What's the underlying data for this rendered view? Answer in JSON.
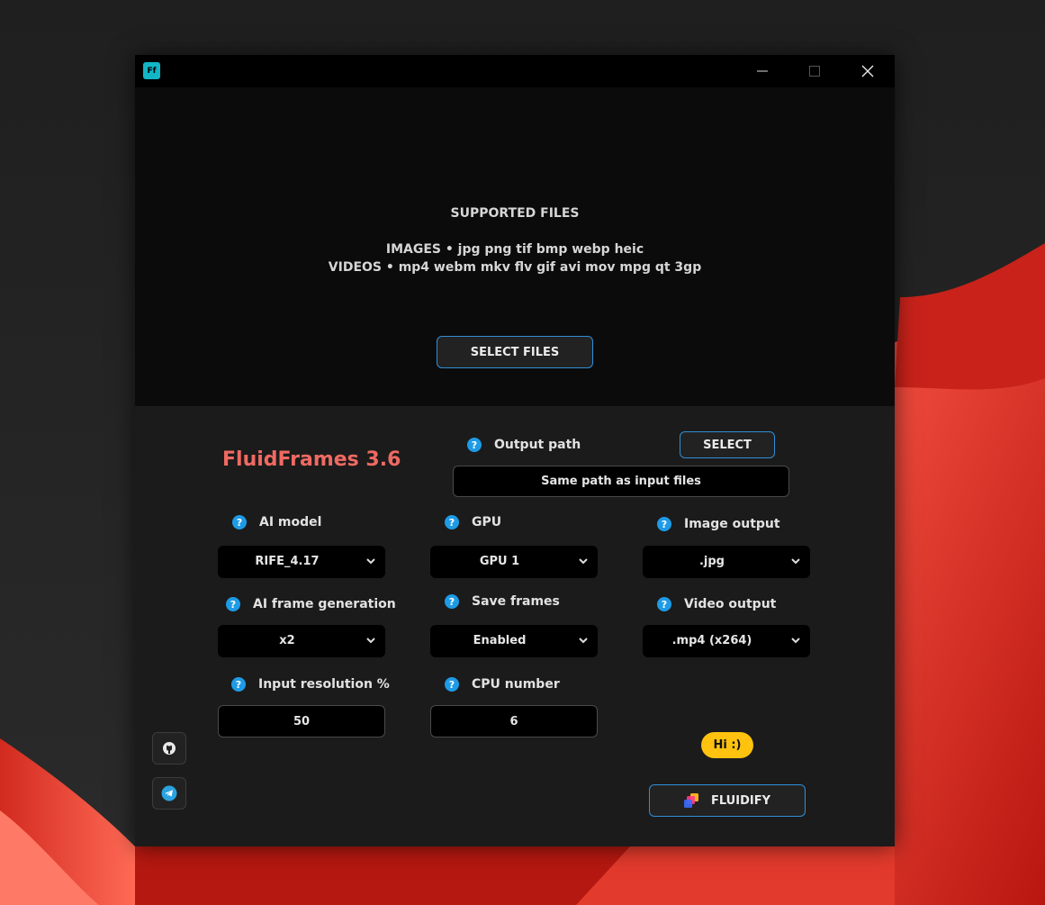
{
  "window": {
    "icon_text": "Ff",
    "controls": {
      "minimize": "—",
      "maximize": "☐",
      "close": "✕"
    }
  },
  "dropzone": {
    "heading": "SUPPORTED FILES",
    "images_line": "IMAGES • jpg png tif bmp webp heic",
    "videos_line": "VIDEOS • mp4 webm mkv flv gif avi mov mpg qt 3gp",
    "select_button": "SELECT FILES"
  },
  "app": {
    "title": "FluidFrames 3.6",
    "output_path": {
      "label": "Output path",
      "select_button": "SELECT",
      "value": "Same path as input files"
    },
    "ai_model": {
      "label": "AI model",
      "value": "RIFE_4.17"
    },
    "gpu": {
      "label": "GPU",
      "value": "GPU 1"
    },
    "image_output": {
      "label": "Image output",
      "value": ".jpg"
    },
    "ai_frame_generation": {
      "label": "AI frame generation",
      "value": "x2"
    },
    "save_frames": {
      "label": "Save frames",
      "value": "Enabled"
    },
    "video_output": {
      "label": "Video output",
      "value": ".mp4 (x264)"
    },
    "input_resolution": {
      "label": "Input resolution %",
      "value": "50"
    },
    "cpu_number": {
      "label": "CPU number",
      "value": "6"
    },
    "help_glyph": "?",
    "hi_badge": "Hi :)",
    "fluidify_button": "FLUIDIFY"
  },
  "colors": {
    "accent_blue": "#1e9be6",
    "title_red": "#ef6a62",
    "badge_yellow": "#ffc20e"
  }
}
